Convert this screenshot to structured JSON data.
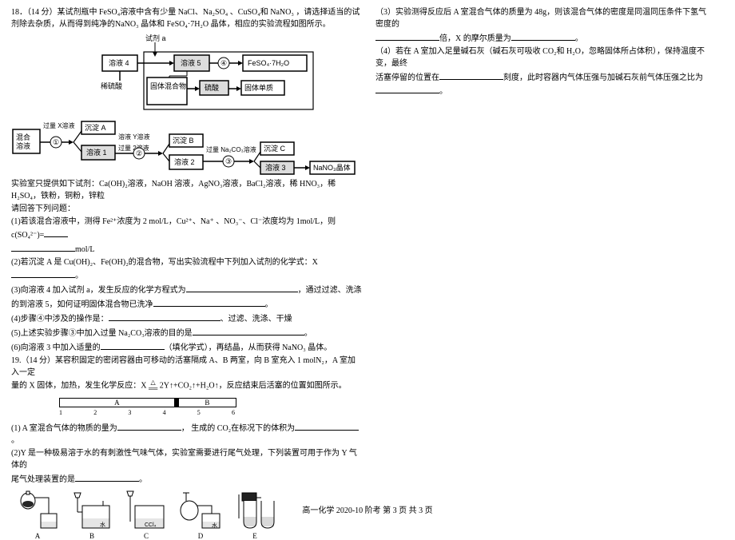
{
  "q18": {
    "header": "18．（14 分）某试剂瓶中 FeSO₄溶液中含有少量 NaCl、Na₂SO₄ 、CuSO₄和 NaNO₃ ，请选择适当的试剂除去杂质，从而得到纯净的NaNO₃ 晶体和 FeSO₄·7H₂O 晶体，相应的实验流程如图所示。",
    "diag": {
      "reagent_a": "试剂 a",
      "sol4": "溶液 4",
      "sol5": "溶液 5",
      "op4": "④",
      "product1": "FeSO₄·7H₂O",
      "dil": "稀硫酸",
      "mixsolid": "固体混合物",
      "h2so4": "硫酸",
      "solid_elem": "固体单质",
      "mix_sol": "混合溶液",
      "excessX": "过量 X溶液",
      "op1": "①",
      "precA": "沉淀 A",
      "sol1": "溶液 1",
      "solY": "溶液 Y溶液",
      "op2": "②",
      "excess2": "过量 2溶液",
      "precB": "沉淀 B",
      "sol2": "溶液 2",
      "na2co3": "过量 Na₂CO₃溶液",
      "op3": "③",
      "precC": "沉淀 C",
      "sol3": "溶液 3",
      "nano3": "NaNO₃晶体"
    },
    "reagents": "实验室只提供如下试剂：Ca(OH)₂溶液，NaOH 溶液，AgNO₃溶液，BaCl₂溶液，稀 HNO₃，稀H₂SO₄，铁粉，铜粉，锌粒",
    "answer_prompt": "请回答下列问题：",
    "p1a": "(1)若该混合溶液中，测得 Fe²⁺浓度为 2 mol/L，Cu²⁺、Na⁺ 、NO₃⁻、Cl⁻浓度均为 1mol/L，则 c(SO₄²⁻)=",
    "p1b": "mol/L",
    "p2a": "(2)若沉淀 A 是 Cu(OH)₂、Fe(OH)₂的混合物，写出实验流程中下列加入试剂的化学式：X",
    "p2b": "。",
    "p3a": "(3)向溶液 4 加入试剂 a，发生反应的化学方程式为",
    "p3b": "，通过过滤、洗涤",
    "p3c": "的到溶液 5，如何证明固体混合物已洗净",
    "p3d": "。",
    "p4a": "(4)步骤④中涉及的操作是：",
    "p4b": "、过滤、洗涤、干燥",
    "p5a": "(5)上述实验步骤③中加入过量 Na₂CO₃溶液的目的是",
    "p5b": "。",
    "p6a": "(6)向溶液 3 中加入适量的",
    "p6b": "（填化学式），再结晶，从而获得 NaNO₃ 晶体。"
  },
  "q19": {
    "header": "19.（14 分）某容积固定的密闭容器由可移动的活塞隔成 A、B 两室，向 B 室充入 1 molN₂，A 室加入一定",
    "header2a": "量的 X 固体，加热，发生化学反应：X",
    "header2b": " 2Y↑+CO₂↑+H₂O↑，反应结束后活塞的位置如图所示。",
    "eq_top": "△",
    "eq_bot": "═",
    "piston": {
      "A": "A",
      "B": "B"
    },
    "scale": [
      "1",
      "2",
      "3",
      "4",
      "5",
      "6"
    ],
    "p1a": "(1) A 室混合气体的物质的量为",
    "p1b": "， 生成的 CO₂在标况下的体积为",
    "p1c": "。",
    "p2a": "(2)Y 是一种极易溶于水的有刺激性气味气体，实验室需要进行尾气处理，下列装置可用于作为 Y 气体的",
    "p2b": "尾气处理装置的是",
    "p2c": "。",
    "labels": {
      "A": "A",
      "B": "B",
      "C": "C",
      "D": "D",
      "E": "E",
      "water": "水",
      "ccl4": "CCl₄"
    }
  },
  "right": {
    "p3a": "（3）实验测得反应后 A 室混合气体的质量为 48g，则该混合气体的密度是同温同压条件下氢气密度的",
    "p3b": "倍，X 的摩尔质量为",
    "p3c": "。",
    "p4a": "（4）若在 A 室加入足量碱石灰（碱石灰可吸收 CO₂和 H₂O，忽略固体所占体积），保持温度不变，最终",
    "p4b": "活塞停留的位置在",
    "p4c": "刻度，此时容器内气体压强与加碱石灰前气体压强之比为",
    "p4d": "。"
  },
  "footer": "高一化学 2020-10 阶考  第 3 页   共 3 页"
}
